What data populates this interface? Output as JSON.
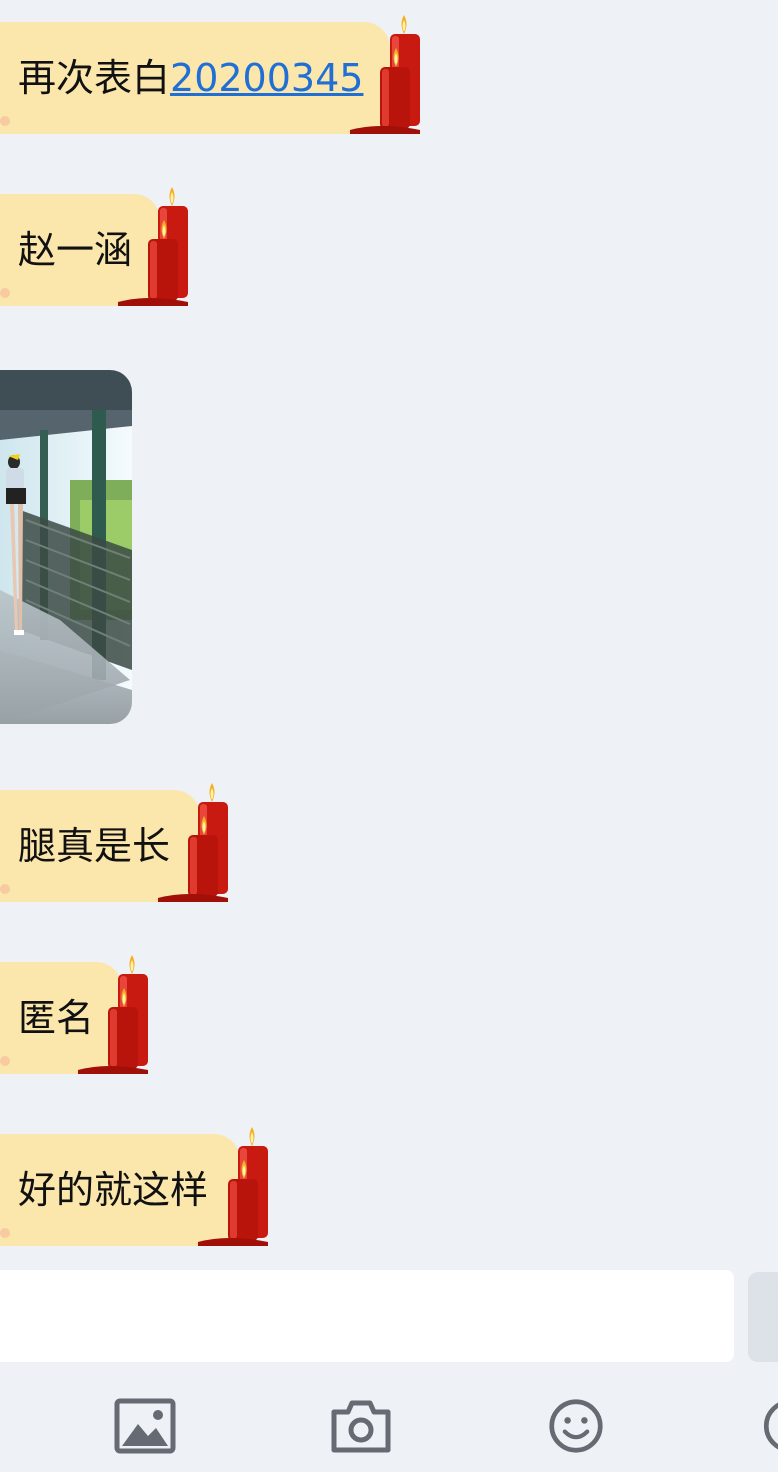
{
  "messages": [
    {
      "text": "再次表白",
      "link": "20200345"
    },
    {
      "text": "赵一涵"
    },
    {
      "type": "image"
    },
    {
      "text": "腿真是长"
    },
    {
      "text": "匿名"
    },
    {
      "text": "好的就这样"
    }
  ],
  "input": {
    "placeholder": "",
    "value": ""
  },
  "toolbar": {
    "icons": [
      "image-icon",
      "camera-icon",
      "emoji-icon",
      "more-icon"
    ]
  },
  "colors": {
    "background": "#eef1f6",
    "bubble": "#fbe6ac",
    "link": "#1f6fd6",
    "candle": "#c81a10",
    "icon": "#666a72"
  }
}
